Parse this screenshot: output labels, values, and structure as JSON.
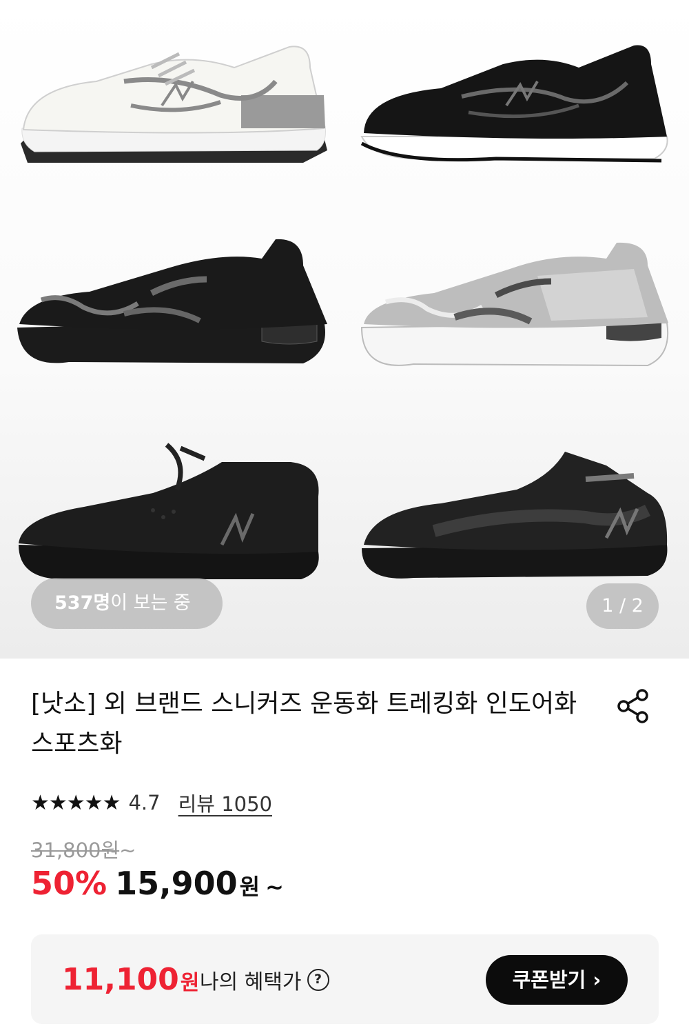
{
  "gallery": {
    "viewers_count": "537명",
    "viewers_suffix": "이 보는 중",
    "pager": "1 / 2"
  },
  "product": {
    "title": "[낫소] 외 브랜드 스니커즈 운동화 트레킹화 인도어화 스포츠화",
    "stars": "★★★★★",
    "rating": "4.7",
    "review_label": "리뷰 1050",
    "original_price": "31,800원",
    "original_suffix": "~",
    "discount": "50%",
    "sale_price": "15,900",
    "currency": "원",
    "sale_suffix": "~"
  },
  "benefit": {
    "price": "11,100",
    "currency": "원",
    "label": "나의 혜택가",
    "help": "?",
    "coupon_button": "쿠폰받기 ›"
  },
  "colors": {
    "accent_red": "#ee2233",
    "button_black": "#0c0c0c"
  },
  "icons": [
    "share-icon",
    "question-icon",
    "star-icon"
  ]
}
